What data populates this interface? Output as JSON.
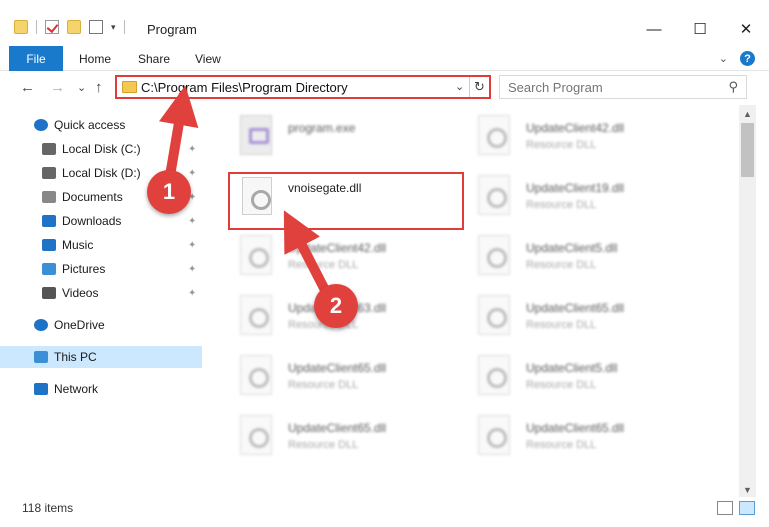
{
  "window": {
    "title": "Program",
    "minimize": "—",
    "maximize": "☐",
    "close": "✕"
  },
  "ribbon": {
    "tabs": [
      "File",
      "Home",
      "Share",
      "View"
    ],
    "expand_glyph": "⌄",
    "help_glyph": "?"
  },
  "address": {
    "path": "C:\\Program Files\\Program Directory",
    "dropdown_glyph": "⌄",
    "refresh_glyph": "↻"
  },
  "search": {
    "placeholder": "Search Program",
    "icon": "search-icon"
  },
  "nav": {
    "back": "←",
    "forward": "→",
    "recent": "⌄",
    "up": "↑"
  },
  "sidebar": {
    "items": [
      {
        "label": "Quick access",
        "icon": "star-icon",
        "pinned": false
      },
      {
        "label": "Local Disk (C:)",
        "icon": "drive-icon",
        "pinned": true
      },
      {
        "label": "Local Disk (D:)",
        "icon": "drive-icon",
        "pinned": true
      },
      {
        "label": "Documents",
        "icon": "documents-icon",
        "pinned": true
      },
      {
        "label": "Downloads",
        "icon": "downloads-icon",
        "pinned": true
      },
      {
        "label": "Music",
        "icon": "music-icon",
        "pinned": true
      },
      {
        "label": "Pictures",
        "icon": "pictures-icon",
        "pinned": true
      },
      {
        "label": "Videos",
        "icon": "videos-icon",
        "pinned": true
      },
      {
        "label": "OneDrive",
        "icon": "cloud-icon",
        "pinned": false
      },
      {
        "label": "This PC",
        "icon": "computer-icon",
        "pinned": false,
        "selected": true
      },
      {
        "label": "Network",
        "icon": "network-icon",
        "pinned": false
      }
    ],
    "pin_glyph": "📌"
  },
  "files": [
    {
      "name": "program.exe",
      "type": "",
      "blurred": true
    },
    {
      "name": "UpdateClient42.dll",
      "type": "Resource DLL",
      "blurred": true
    },
    {
      "name": "vnoisegate.dll",
      "type": "",
      "blurred": false
    },
    {
      "name": "UpdateClient19.dll",
      "type": "Resource DLL",
      "blurred": true
    },
    {
      "name": "UpdateClient42.dll",
      "type": "Resource DLL",
      "blurred": true
    },
    {
      "name": "UpdateClient5.dll",
      "type": "Resource DLL",
      "blurred": true
    },
    {
      "name": "UpdateClient63.dll",
      "type": "Resource DLL",
      "blurred": true
    },
    {
      "name": "UpdateClient65.dll",
      "type": "Resource DLL",
      "blurred": true
    },
    {
      "name": "UpdateClient65.dll",
      "type": "Resource DLL",
      "blurred": true
    },
    {
      "name": "UpdateClient5.dll",
      "type": "Resource DLL",
      "blurred": true
    },
    {
      "name": "UpdateClient65.dll",
      "type": "Resource DLL",
      "blurred": true
    },
    {
      "name": "UpdateClient65.dll",
      "type": "Resource DLL",
      "blurred": true
    }
  ],
  "status": {
    "item_count": "118 items"
  },
  "annotations": {
    "step1": "1",
    "step2": "2",
    "color": "#e0413d"
  },
  "colors": {
    "accent": "#1979ca",
    "selection": "#cce8ff",
    "highlight_border": "#e23b3b"
  }
}
